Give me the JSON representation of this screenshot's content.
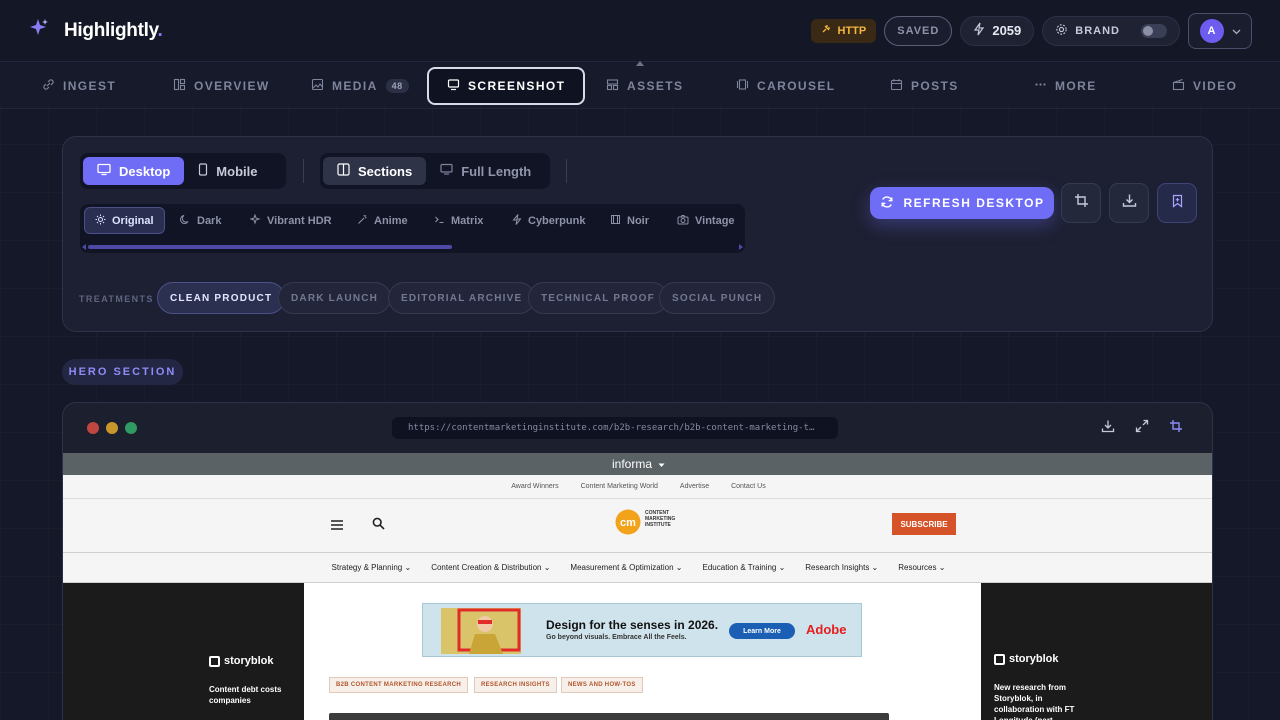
{
  "app": {
    "name": "Highlightly",
    "name_dot": ".",
    "http_label": "HTTP",
    "saved_label": "SAVED",
    "count": "2059",
    "brand_label": "BRAND",
    "avatar_initial": "A"
  },
  "tabs": [
    {
      "label": "INGEST"
    },
    {
      "label": "OVERVIEW"
    },
    {
      "label": "MEDIA",
      "badge": "48"
    },
    {
      "label": "SCREENSHOT",
      "active": true
    },
    {
      "label": "ASSETS"
    },
    {
      "label": "CAROUSEL"
    },
    {
      "label": "POSTS"
    },
    {
      "label": "MORE"
    },
    {
      "label": "VIDEO"
    }
  ],
  "controls": {
    "device": [
      {
        "label": "Desktop",
        "active": true
      },
      {
        "label": "Mobile"
      }
    ],
    "mode": [
      {
        "label": "Sections",
        "active": true
      },
      {
        "label": "Full Length"
      }
    ],
    "filters": [
      {
        "label": "Original",
        "active": true
      },
      {
        "label": "Dark"
      },
      {
        "label": "Vibrant HDR"
      },
      {
        "label": "Anime"
      },
      {
        "label": "Matrix"
      },
      {
        "label": "Cyberpunk"
      },
      {
        "label": "Noir"
      },
      {
        "label": "Vintage"
      }
    ],
    "filter_scroll_fraction": 0.56,
    "treatments_label": "TREATMENTS",
    "treatments": [
      {
        "label": "CLEAN PRODUCT",
        "active": true
      },
      {
        "label": "DARK LAUNCH"
      },
      {
        "label": "EDITORIAL ARCHIVE"
      },
      {
        "label": "TECHNICAL PROOF"
      },
      {
        "label": "SOCIAL PUNCH"
      }
    ],
    "refresh_label": "REFRESH DESKTOP"
  },
  "section": {
    "label": "HERO SECTION"
  },
  "browser": {
    "url": "https://contentmarketinginstitute.com/b2b-research/b2b-content-marketing-t…",
    "dot_colors": [
      "#c0473f",
      "#c9962b",
      "#2f9b62"
    ]
  },
  "site": {
    "top_brand": "informa",
    "util_links": [
      "Award Winners",
      "Content Marketing World",
      "Advertise",
      "Contact Us"
    ],
    "logo_line1": "CONTENT",
    "logo_line2": "MARKETING",
    "logo_line3": "INSTITUTE",
    "subscribe": "SUBSCRIBE",
    "nav": [
      "Strategy & Planning",
      "Content Creation & Distribution",
      "Measurement & Optimization",
      "Education & Training",
      "Research Insights",
      "Resources"
    ],
    "ad_title": "Design for the senses in 2026.",
    "ad_sub": "Go beyond visuals. Embrace All the Feels.",
    "ad_button": "Learn More",
    "ad_brand": "Adobe",
    "tags": [
      "B2B CONTENT MARKETING RESEARCH",
      "RESEARCH INSIGHTS",
      "NEWS AND HOW-TOS"
    ],
    "left_brand": "storyblok",
    "left_text": "Content debt costs companies",
    "right_brand": "storyblok",
    "right_text": "New research from Storyblok, in collaboration with FT Longitude (part"
  }
}
